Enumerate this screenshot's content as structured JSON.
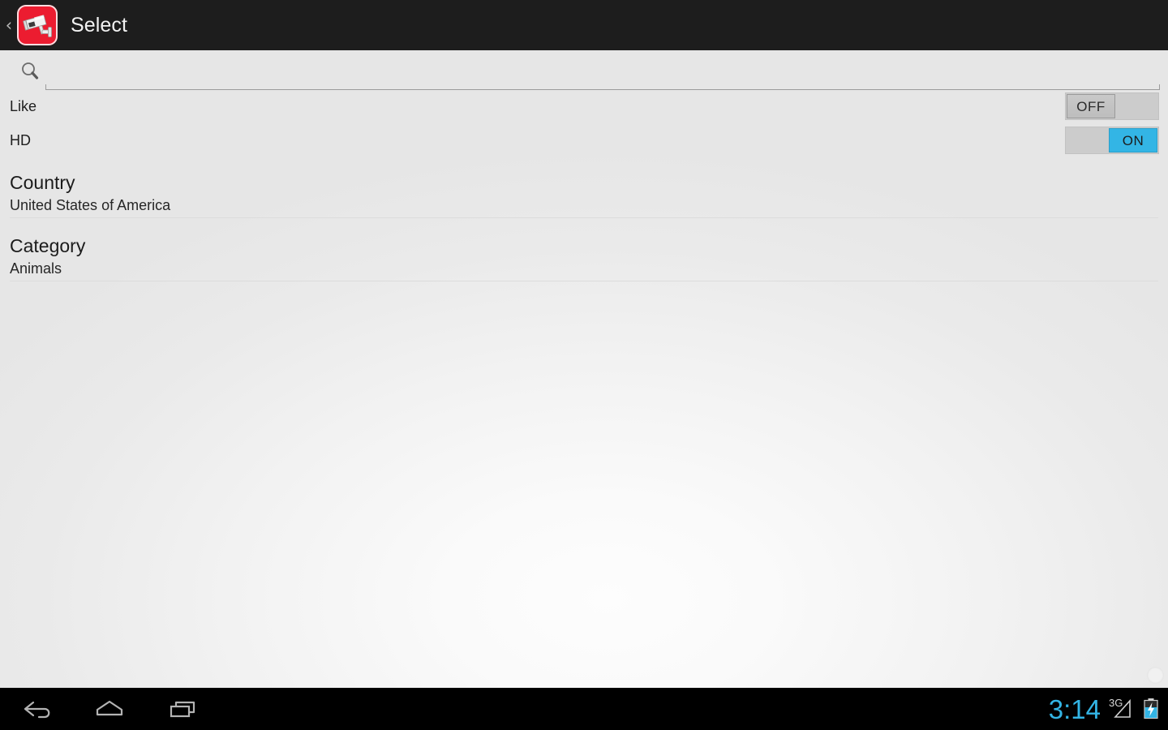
{
  "app": {
    "title": "Select",
    "icon_name": "security-camera-icon",
    "icon_bg_color": "#ec1c30",
    "back_chevron": "‹"
  },
  "search": {
    "icon_name": "search-icon",
    "value": "",
    "placeholder": ""
  },
  "switches": [
    {
      "label": "Like",
      "state_label": "OFF",
      "state": "off"
    },
    {
      "label": "HD",
      "state_label": "ON",
      "state": "on"
    }
  ],
  "sections": [
    {
      "title": "Country",
      "value": "United States of America"
    },
    {
      "title": "Category",
      "value": "Animals"
    }
  ],
  "system_bar": {
    "back_label": "back-icon",
    "home_label": "home-icon",
    "recents_label": "recent-apps-icon",
    "clock": "3:14",
    "network_type": "3G",
    "signal_icon": "signal-triangle-icon",
    "battery_icon": "battery-charging-icon",
    "accent_color": "#33b5e5"
  }
}
